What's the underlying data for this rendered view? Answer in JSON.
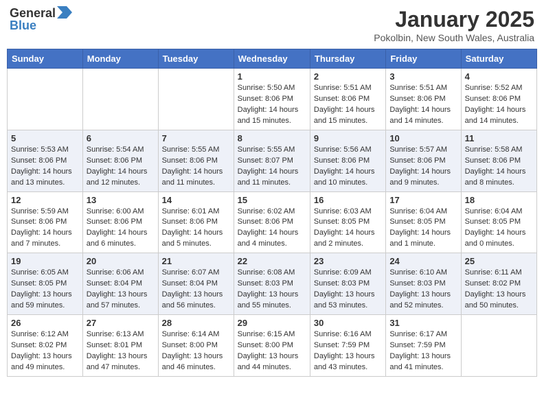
{
  "logo": {
    "general": "General",
    "blue": "Blue"
  },
  "title": "January 2025",
  "location": "Pokolbin, New South Wales, Australia",
  "days_of_week": [
    "Sunday",
    "Monday",
    "Tuesday",
    "Wednesday",
    "Thursday",
    "Friday",
    "Saturday"
  ],
  "weeks": [
    [
      {
        "day": "",
        "info": ""
      },
      {
        "day": "",
        "info": ""
      },
      {
        "day": "",
        "info": ""
      },
      {
        "day": "1",
        "info": "Sunrise: 5:50 AM\nSunset: 8:06 PM\nDaylight: 14 hours\nand 15 minutes."
      },
      {
        "day": "2",
        "info": "Sunrise: 5:51 AM\nSunset: 8:06 PM\nDaylight: 14 hours\nand 15 minutes."
      },
      {
        "day": "3",
        "info": "Sunrise: 5:51 AM\nSunset: 8:06 PM\nDaylight: 14 hours\nand 14 minutes."
      },
      {
        "day": "4",
        "info": "Sunrise: 5:52 AM\nSunset: 8:06 PM\nDaylight: 14 hours\nand 14 minutes."
      }
    ],
    [
      {
        "day": "5",
        "info": "Sunrise: 5:53 AM\nSunset: 8:06 PM\nDaylight: 14 hours\nand 13 minutes."
      },
      {
        "day": "6",
        "info": "Sunrise: 5:54 AM\nSunset: 8:06 PM\nDaylight: 14 hours\nand 12 minutes."
      },
      {
        "day": "7",
        "info": "Sunrise: 5:55 AM\nSunset: 8:06 PM\nDaylight: 14 hours\nand 11 minutes."
      },
      {
        "day": "8",
        "info": "Sunrise: 5:55 AM\nSunset: 8:07 PM\nDaylight: 14 hours\nand 11 minutes."
      },
      {
        "day": "9",
        "info": "Sunrise: 5:56 AM\nSunset: 8:06 PM\nDaylight: 14 hours\nand 10 minutes."
      },
      {
        "day": "10",
        "info": "Sunrise: 5:57 AM\nSunset: 8:06 PM\nDaylight: 14 hours\nand 9 minutes."
      },
      {
        "day": "11",
        "info": "Sunrise: 5:58 AM\nSunset: 8:06 PM\nDaylight: 14 hours\nand 8 minutes."
      }
    ],
    [
      {
        "day": "12",
        "info": "Sunrise: 5:59 AM\nSunset: 8:06 PM\nDaylight: 14 hours\nand 7 minutes."
      },
      {
        "day": "13",
        "info": "Sunrise: 6:00 AM\nSunset: 8:06 PM\nDaylight: 14 hours\nand 6 minutes."
      },
      {
        "day": "14",
        "info": "Sunrise: 6:01 AM\nSunset: 8:06 PM\nDaylight: 14 hours\nand 5 minutes."
      },
      {
        "day": "15",
        "info": "Sunrise: 6:02 AM\nSunset: 8:06 PM\nDaylight: 14 hours\nand 4 minutes."
      },
      {
        "day": "16",
        "info": "Sunrise: 6:03 AM\nSunset: 8:05 PM\nDaylight: 14 hours\nand 2 minutes."
      },
      {
        "day": "17",
        "info": "Sunrise: 6:04 AM\nSunset: 8:05 PM\nDaylight: 14 hours\nand 1 minute."
      },
      {
        "day": "18",
        "info": "Sunrise: 6:04 AM\nSunset: 8:05 PM\nDaylight: 14 hours\nand 0 minutes."
      }
    ],
    [
      {
        "day": "19",
        "info": "Sunrise: 6:05 AM\nSunset: 8:05 PM\nDaylight: 13 hours\nand 59 minutes."
      },
      {
        "day": "20",
        "info": "Sunrise: 6:06 AM\nSunset: 8:04 PM\nDaylight: 13 hours\nand 57 minutes."
      },
      {
        "day": "21",
        "info": "Sunrise: 6:07 AM\nSunset: 8:04 PM\nDaylight: 13 hours\nand 56 minutes."
      },
      {
        "day": "22",
        "info": "Sunrise: 6:08 AM\nSunset: 8:03 PM\nDaylight: 13 hours\nand 55 minutes."
      },
      {
        "day": "23",
        "info": "Sunrise: 6:09 AM\nSunset: 8:03 PM\nDaylight: 13 hours\nand 53 minutes."
      },
      {
        "day": "24",
        "info": "Sunrise: 6:10 AM\nSunset: 8:03 PM\nDaylight: 13 hours\nand 52 minutes."
      },
      {
        "day": "25",
        "info": "Sunrise: 6:11 AM\nSunset: 8:02 PM\nDaylight: 13 hours\nand 50 minutes."
      }
    ],
    [
      {
        "day": "26",
        "info": "Sunrise: 6:12 AM\nSunset: 8:02 PM\nDaylight: 13 hours\nand 49 minutes."
      },
      {
        "day": "27",
        "info": "Sunrise: 6:13 AM\nSunset: 8:01 PM\nDaylight: 13 hours\nand 47 minutes."
      },
      {
        "day": "28",
        "info": "Sunrise: 6:14 AM\nSunset: 8:00 PM\nDaylight: 13 hours\nand 46 minutes."
      },
      {
        "day": "29",
        "info": "Sunrise: 6:15 AM\nSunset: 8:00 PM\nDaylight: 13 hours\nand 44 minutes."
      },
      {
        "day": "30",
        "info": "Sunrise: 6:16 AM\nSunset: 7:59 PM\nDaylight: 13 hours\nand 43 minutes."
      },
      {
        "day": "31",
        "info": "Sunrise: 6:17 AM\nSunset: 7:59 PM\nDaylight: 13 hours\nand 41 minutes."
      },
      {
        "day": "",
        "info": ""
      }
    ]
  ]
}
